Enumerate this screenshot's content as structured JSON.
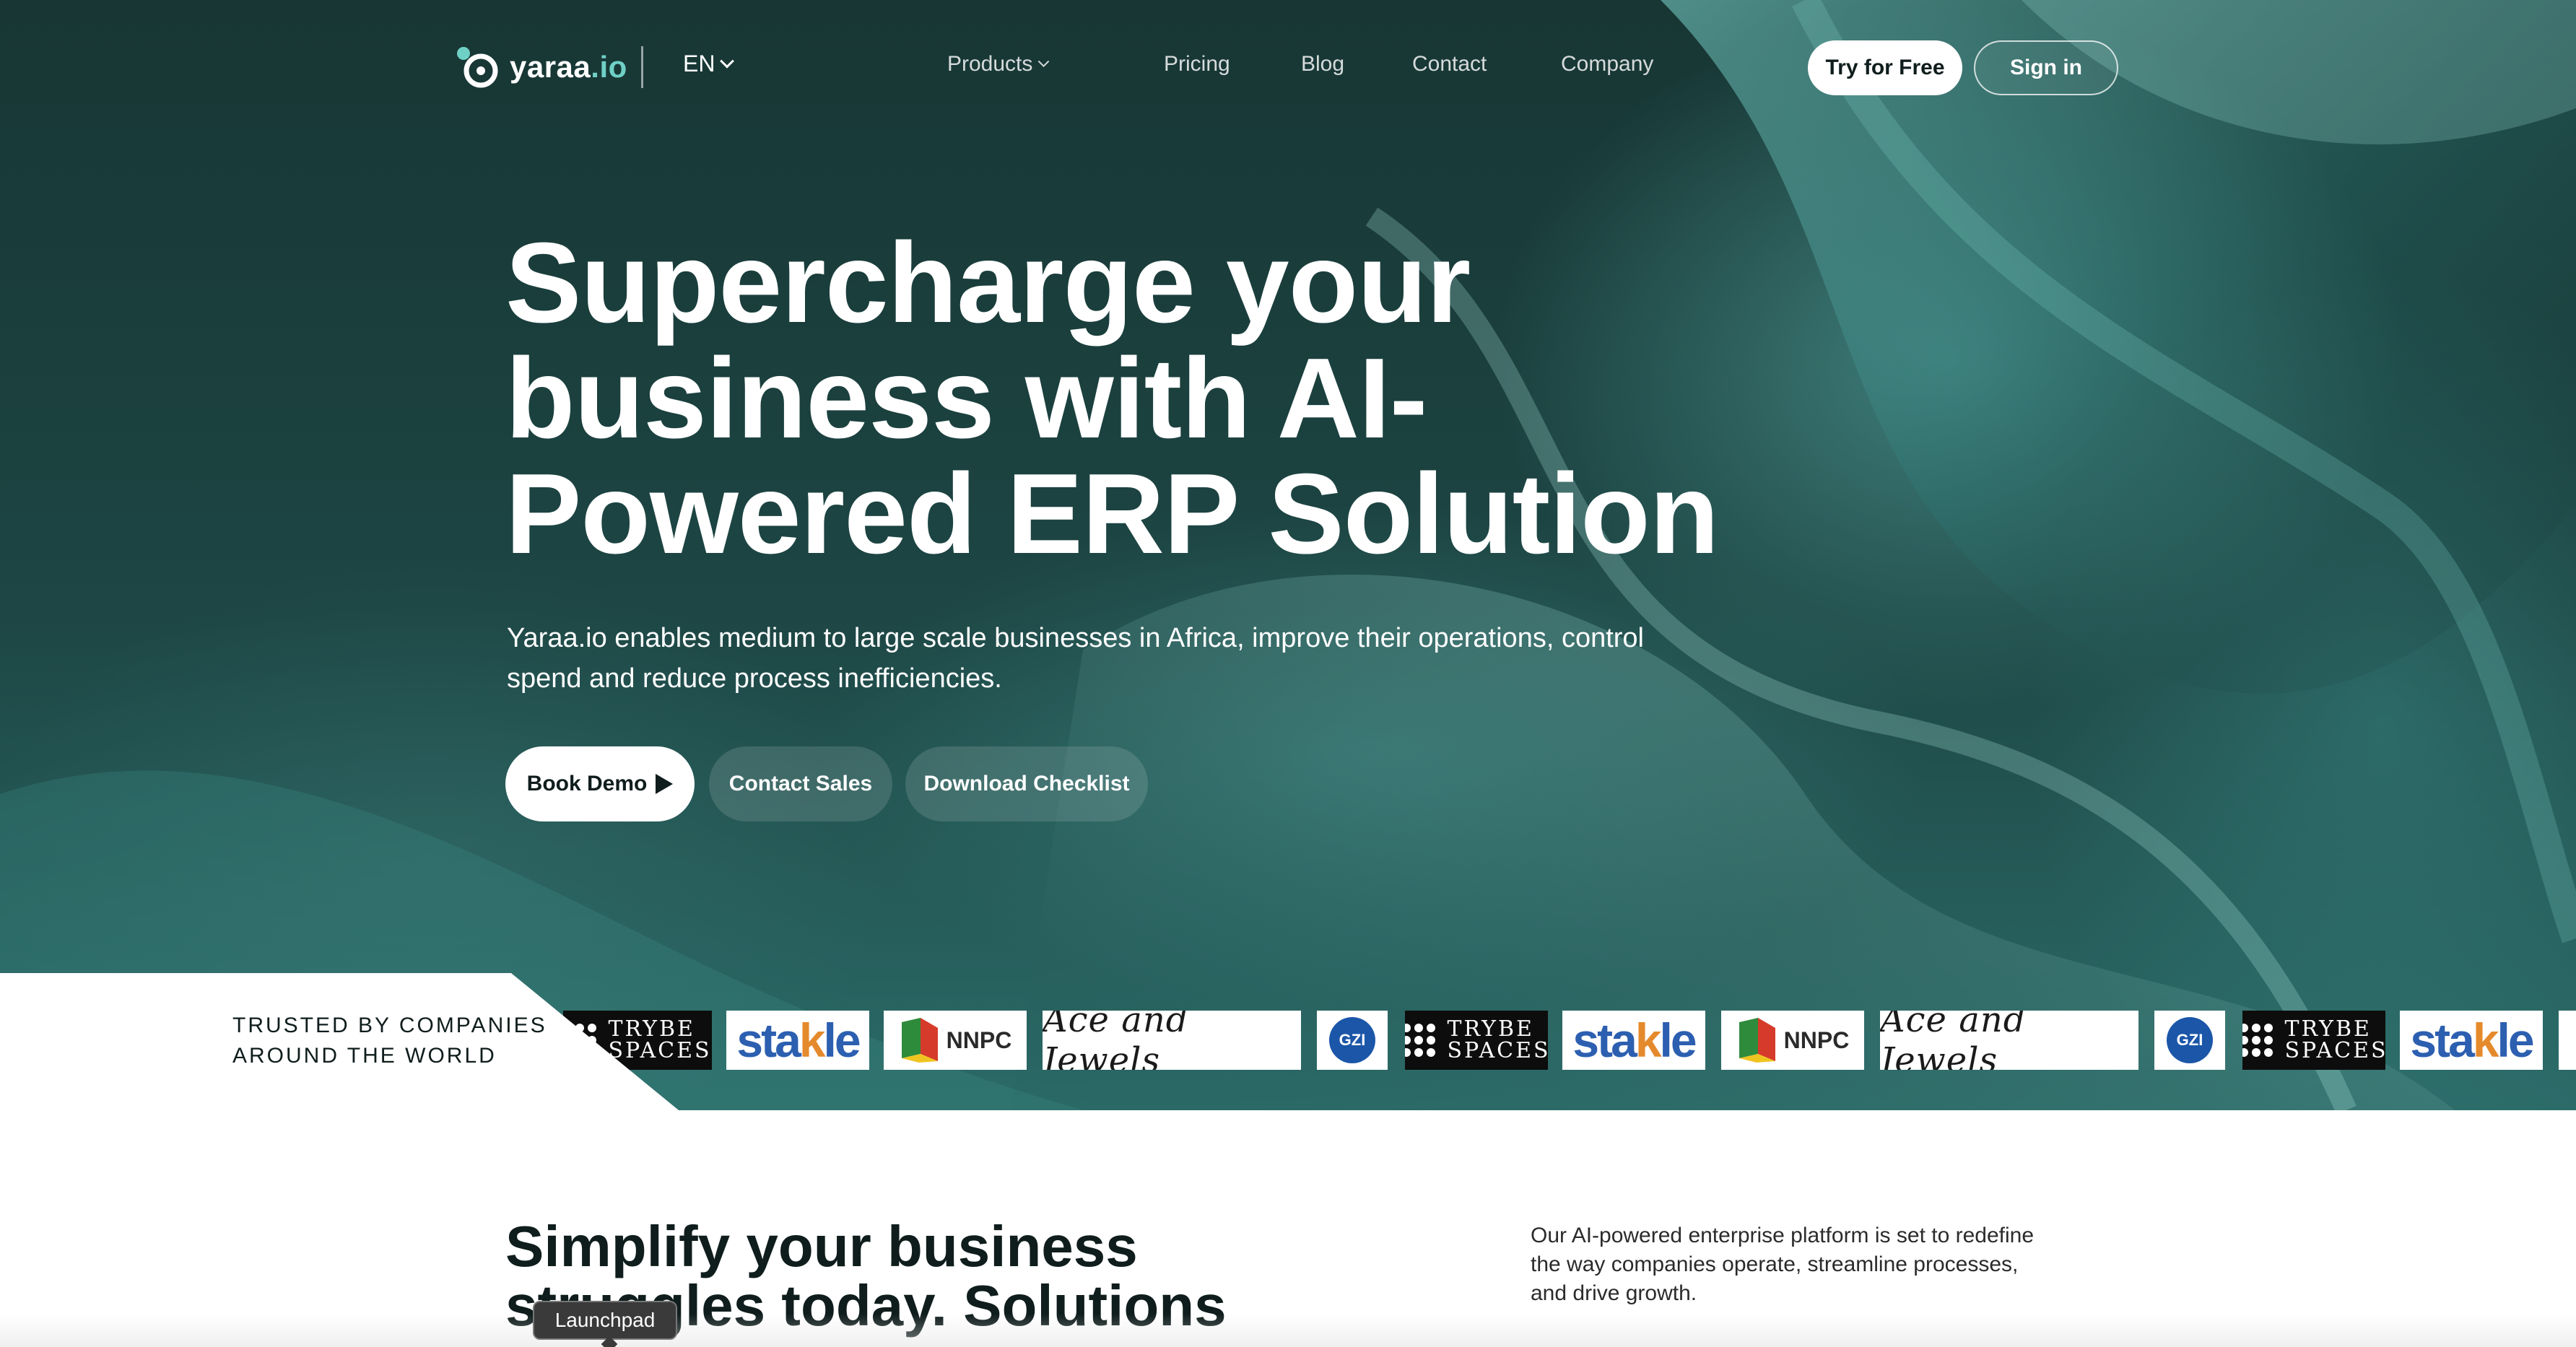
{
  "colors": {
    "hero_bg": "#1d4644",
    "accent_teal": "#6fd0c6",
    "primary_button_bg": "#ffffff",
    "text_dark": "#0f1d1c"
  },
  "nav": {
    "logo_text": "yaraa",
    "logo_suffix": ".io",
    "logo_icon": "yaraa-logo-icon",
    "language": "EN",
    "links": [
      {
        "label": "Products",
        "has_dropdown": true
      },
      {
        "label": "Pricing"
      },
      {
        "label": "Blog"
      },
      {
        "label": "Contact"
      },
      {
        "label": "Company"
      }
    ],
    "try_free": "Try for Free",
    "sign_in": "Sign in"
  },
  "hero": {
    "headline_lines": [
      "Supercharge your",
      "business with AI-",
      "Powered ERP Solution"
    ],
    "subtext_lines": [
      "Yaraa.io enables medium to large scale businesses in Africa, improve their operations, control",
      "spend and reduce process inefficiencies."
    ],
    "buttons": {
      "book_demo": "Book Demo",
      "contact_sales": "Contact Sales",
      "download_checklist": "Download Checklist"
    }
  },
  "trusted": {
    "label_lines": [
      "TRUSTED BY COMPANIES",
      "AROUND THE WORLD"
    ],
    "logos": [
      {
        "name": "trybe-spaces",
        "line1": "TRYBE",
        "line2": "SPACES"
      },
      {
        "name": "stakle",
        "text_a": "sta",
        "text_k": "k",
        "text_b": "le"
      },
      {
        "name": "nnpc",
        "text": "NNPC"
      },
      {
        "name": "ace-and-jewels",
        "text": "Ace and Jewels"
      },
      {
        "name": "gzi",
        "text": "GZI"
      }
    ]
  },
  "section": {
    "title_lines": [
      "Simplify your business",
      "struggles today. Solutions"
    ],
    "description_lines": [
      "Our AI-powered enterprise platform is set to redefine",
      "the way companies operate, streamline processes,",
      "and drive growth."
    ]
  },
  "tooltip": {
    "text": "Launchpad"
  }
}
